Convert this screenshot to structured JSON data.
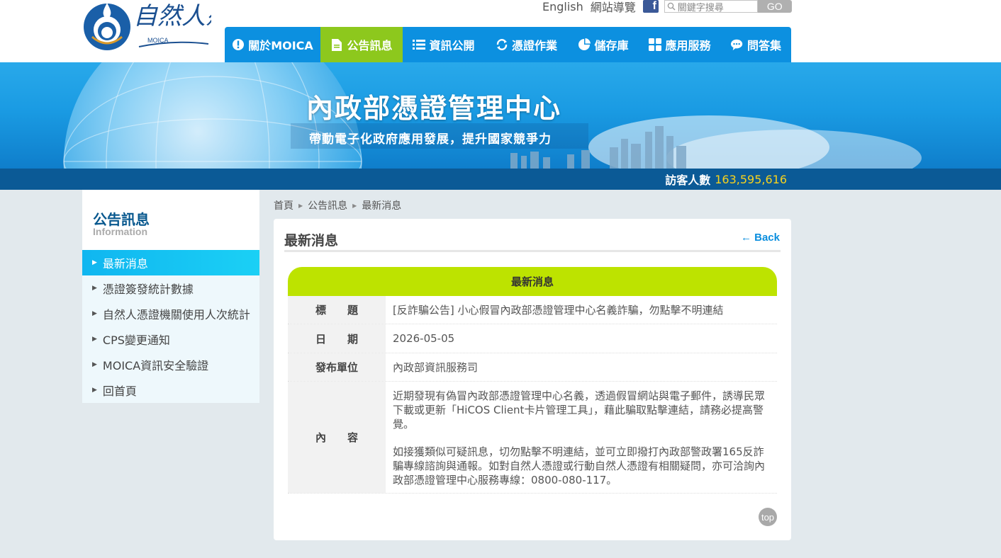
{
  "header": {
    "logo_text": "自然人憑證",
    "logo_sub": "MOICA",
    "toplinks": {
      "english": "English",
      "sitemap": "網站導覽"
    },
    "search": {
      "placeholder": "關鍵字搜尋",
      "go_label": "GO"
    },
    "nav": [
      {
        "label": "關於MOICA",
        "icon": "info-icon"
      },
      {
        "label": "公告訊息",
        "icon": "document-icon"
      },
      {
        "label": "資訊公開",
        "icon": "list-icon"
      },
      {
        "label": "憑證作業",
        "icon": "refresh-icon"
      },
      {
        "label": "儲存庫",
        "icon": "pie-icon"
      },
      {
        "label": "應用服務",
        "icon": "grid-icon"
      },
      {
        "label": "問答集",
        "icon": "chat-icon"
      }
    ],
    "active_nav": 1
  },
  "banner": {
    "title": "內政部憑證管理中心",
    "subtitle": "帶動電子化政府應用發展，提升國家競爭力"
  },
  "visitor": {
    "label": "訪客人數",
    "count": "163,595,616"
  },
  "sidebar": {
    "title": "公告訊息",
    "subtitle": "Information",
    "items": [
      {
        "label": "最新消息",
        "active": true
      },
      {
        "label": "憑證簽發統計數據"
      },
      {
        "label": "自然人憑證機關使用人次統計"
      },
      {
        "label": "CPS變更通知"
      },
      {
        "label": "MOICA資訊安全驗證"
      },
      {
        "label": "回首頁"
      }
    ]
  },
  "breadcrumb": [
    "首頁",
    "公告訊息",
    "最新消息"
  ],
  "content": {
    "title": "最新消息",
    "back_label": "← Back",
    "table_header": "最新消息",
    "rows": {
      "title": {
        "label": "標　　題",
        "value": "[反詐騙公告] 小心假冒內政部憑證管理中心名義詐騙，勿點擊不明連結"
      },
      "date": {
        "label": "日　　期",
        "value": "2026-05-05"
      },
      "unit": {
        "label": "發布單位",
        "value": "內政部資訊服務司"
      },
      "body": {
        "label": "內　　容",
        "p1": "近期發現有偽冒內政部憑證管理中心名義，透過假冒網站與電子郵件，誘導民眾下載或更新「HiCOS Client卡片管理工具」，藉此騙取點擊連結，請務必提高警覺。",
        "p2": "如接獲類似可疑訊息，切勿點擊不明連結，並可立即撥打內政部警政署165反詐騙專線諮詢與通報。如對自然人憑證或行動自然人憑證有相關疑問，亦可洽詢內政部憑證管理中心服務專線：0800-080-117。"
      }
    },
    "top_label": "top"
  },
  "colors": {
    "nav_blue": "#0c90e0",
    "nav_active": "#8dc81d",
    "table_head": "#bde300",
    "visitor_bar": "#0b5a96",
    "visitor_count": "#f8d21c"
  }
}
